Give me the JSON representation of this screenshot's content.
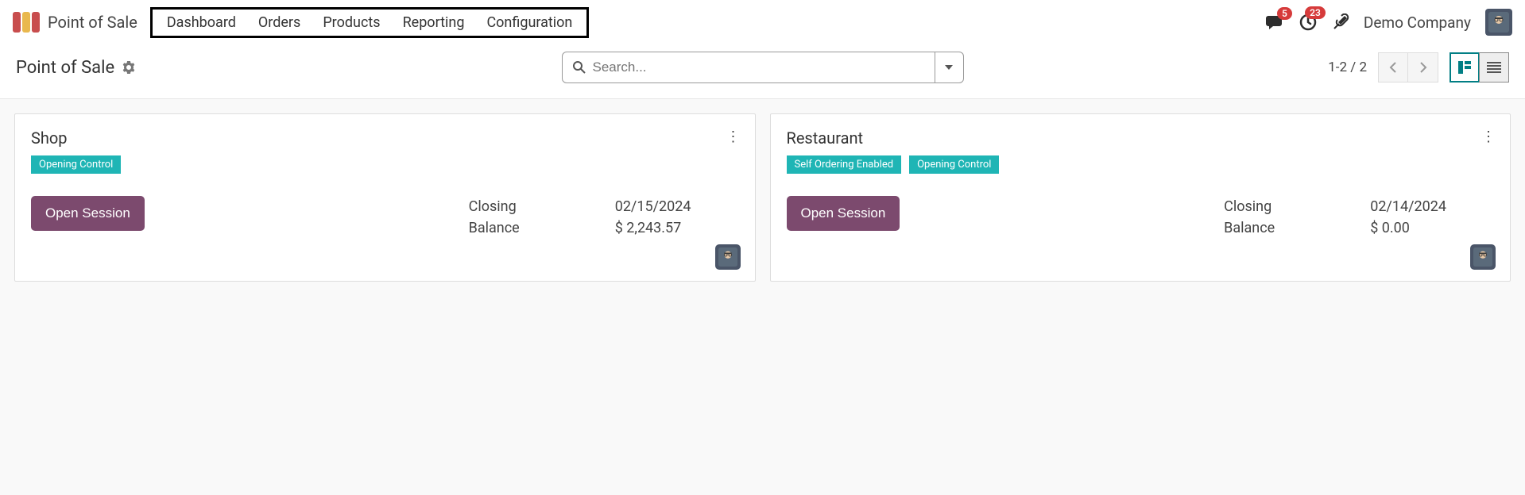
{
  "header": {
    "app_name": "Point of Sale",
    "nav": [
      "Dashboard",
      "Orders",
      "Products",
      "Reporting",
      "Configuration"
    ],
    "messages_badge": "5",
    "activities_badge": "23",
    "company": "Demo Company"
  },
  "control": {
    "breadcrumb": "Point of Sale",
    "search_placeholder": "Search...",
    "pager": "1-2 / 2"
  },
  "cards": [
    {
      "title": "Shop",
      "tags": [
        "Opening Control"
      ],
      "open_label": "Open Session",
      "closing_label": "Closing",
      "closing_value": "02/15/2024",
      "balance_label": "Balance",
      "balance_value": "$ 2,243.57"
    },
    {
      "title": "Restaurant",
      "tags": [
        "Self Ordering Enabled",
        "Opening Control"
      ],
      "open_label": "Open Session",
      "closing_label": "Closing",
      "closing_value": "02/14/2024",
      "balance_label": "Balance",
      "balance_value": "$ 0.00"
    }
  ]
}
